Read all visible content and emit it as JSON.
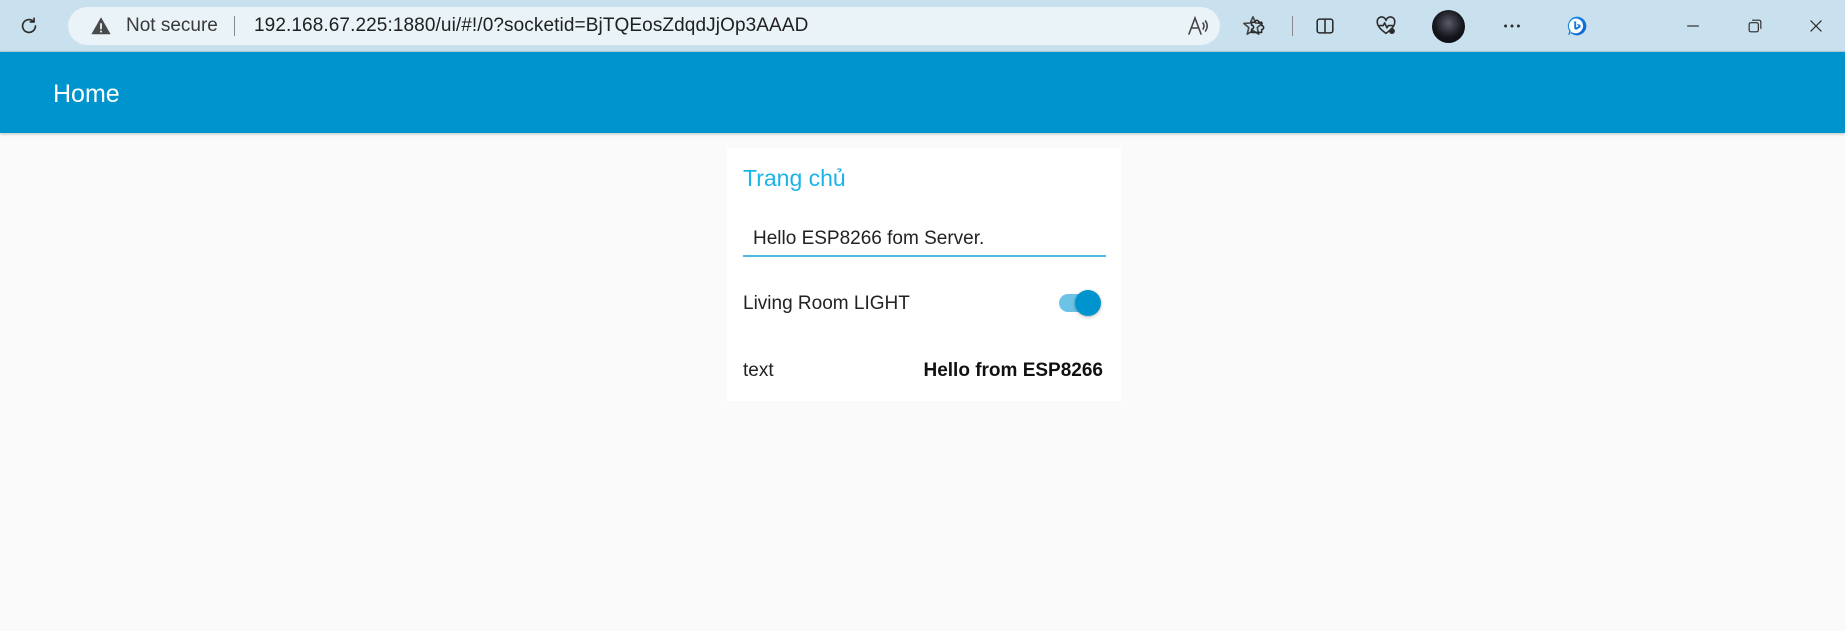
{
  "browser": {
    "security_label": "Not secure",
    "url": "192.168.67.225:1880/ui/#!/0?socketid=BjTQEosZdqdJjOp3AAAD",
    "icons": {
      "refresh": "refresh-icon",
      "warning": "warning-icon",
      "read_aloud": "read-aloud-icon",
      "favorite": "star-icon",
      "extensions": "puzzle-icon",
      "split_screen": "split-screen-icon",
      "health": "heart-pulse-icon",
      "more": "more-icon",
      "copilot": "bing-copilot-icon",
      "minimize": "minimize-icon",
      "restore": "restore-icon",
      "close": "close-icon"
    }
  },
  "header": {
    "title": "Home",
    "color": "#0094ce"
  },
  "card": {
    "group_title": "Trang chủ",
    "text_input": {
      "value": "Hello ESP8266 fom Server."
    },
    "switch": {
      "label": "Living Room LIGHT",
      "state": "on"
    },
    "text_row": {
      "label": "text",
      "value": "Hello from ESP8266"
    }
  },
  "colors": {
    "accent": "#0094ce",
    "group_title": "#1bb4e8",
    "page_background": "#fafafa"
  }
}
